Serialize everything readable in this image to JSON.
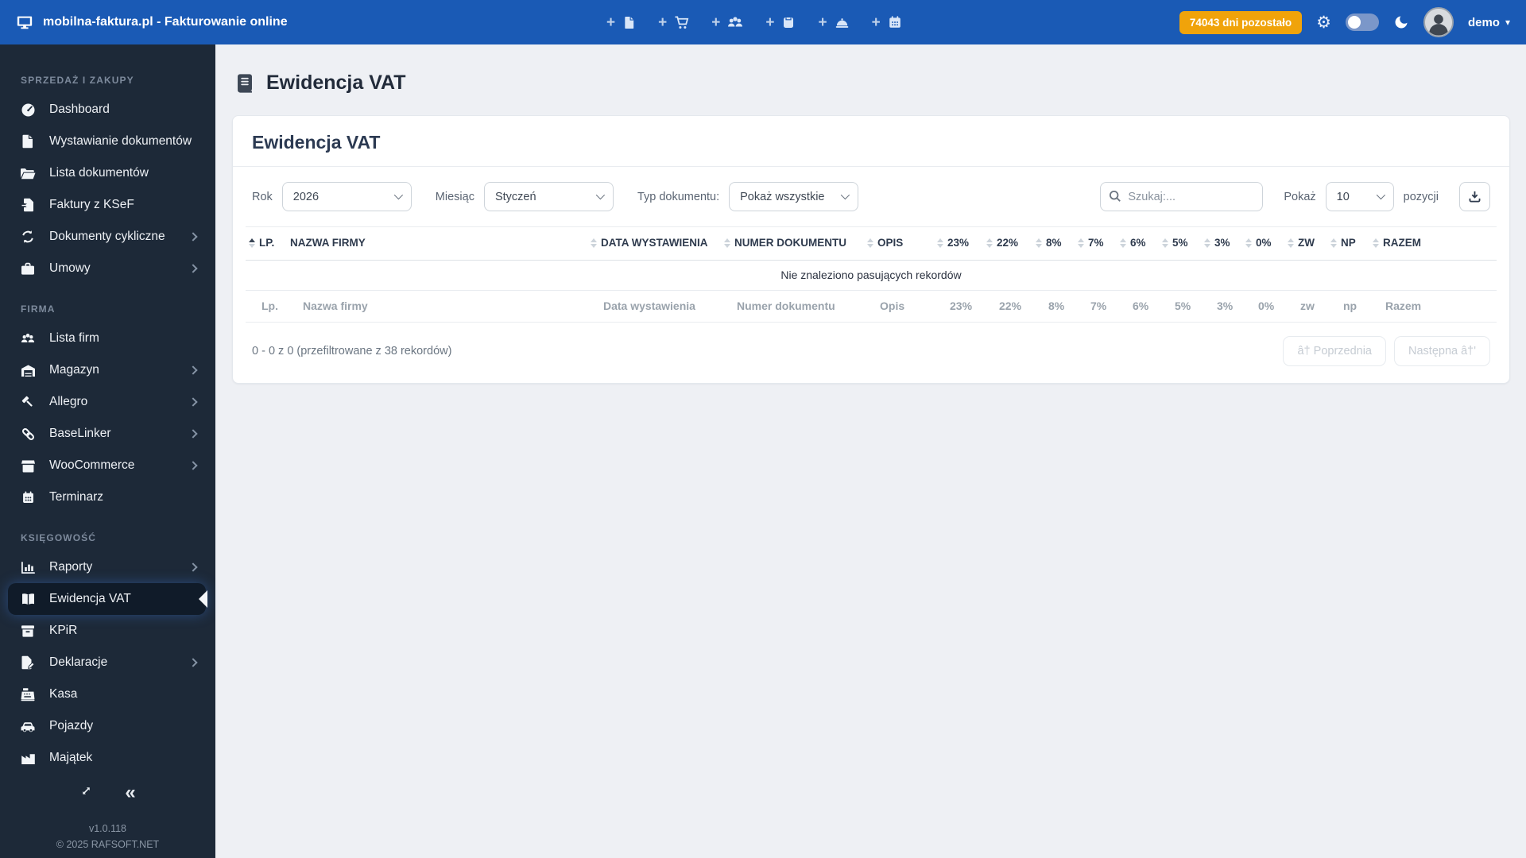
{
  "topbar": {
    "brand": "mobilna-faktura.pl - Fakturowanie online",
    "quick_add": [
      {
        "icon": "add-document-icon"
      },
      {
        "icon": "add-cart-icon"
      },
      {
        "icon": "add-contractor-icon"
      },
      {
        "icon": "add-product-icon"
      },
      {
        "icon": "add-service-icon"
      },
      {
        "icon": "add-event-icon"
      }
    ],
    "trial_badge": "74043 dni pozostało",
    "user": "demo"
  },
  "icons": {
    "plus": "+",
    "gear": "⚙",
    "collapse": "«",
    "caret_down": "▾"
  },
  "sidebar": {
    "sections": [
      {
        "label": "SPRZEDAŻ I ZAKUPY",
        "items": [
          {
            "label": "Dashboard"
          },
          {
            "label": "Wystawianie dokumentów"
          },
          {
            "label": "Lista dokumentów"
          },
          {
            "label": "Faktury z KSeF"
          },
          {
            "label": "Dokumenty cykliczne"
          },
          {
            "label": "Umowy"
          }
        ]
      },
      {
        "label": "FIRMA",
        "items": [
          {
            "label": "Lista firm"
          },
          {
            "label": "Magazyn"
          },
          {
            "label": "Allegro"
          },
          {
            "label": "BaseLinker"
          },
          {
            "label": "WooCommerce"
          },
          {
            "label": "Terminarz"
          }
        ]
      },
      {
        "label": "KSIĘGOWOŚĆ",
        "items": [
          {
            "label": "Raporty"
          },
          {
            "label": "Ewidencja VAT"
          },
          {
            "label": "KPiR"
          },
          {
            "label": "Deklaracje"
          },
          {
            "label": "Kasa"
          },
          {
            "label": "Pojazdy"
          },
          {
            "label": "Majątek"
          }
        ]
      }
    ],
    "footer": {
      "version": "v1.0.118",
      "copyright": "© 2025 RAFSOFT.NET"
    }
  },
  "page": {
    "title": "Ewidencja VAT"
  },
  "card": {
    "title": "Ewidencja VAT",
    "filters": {
      "rok_label": "Rok",
      "rok_value": "2026",
      "miesiac_label": "Miesiąc",
      "miesiac_value": "Styczeń",
      "typ_label": "Typ dokumentu:",
      "typ_value": "Pokaż wszystkie",
      "search_placeholder": "Szukaj:...",
      "pokaz_label": "Pokaż",
      "page_size": "10",
      "pozycji_label": "pozycji"
    },
    "table": {
      "headers": [
        "LP.",
        "NAZWA FIRMY",
        "DATA WYSTAWIENIA",
        "NUMER DOKUMENTU",
        "OPIS",
        "23%",
        "22%",
        "8%",
        "7%",
        "6%",
        "5%",
        "3%",
        "0%",
        "ZW",
        "NP",
        "RAZEM"
      ],
      "empty": "Nie znaleziono pasujących rekordów",
      "footer": [
        "Lp.",
        "Nazwa firmy",
        "Data wystawienia",
        "Numer dokumentu",
        "Opis",
        "23%",
        "22%",
        "8%",
        "7%",
        "6%",
        "5%",
        "3%",
        "0%",
        "zw",
        "np",
        "Razem"
      ]
    },
    "pagination": {
      "info": "0 - 0 z 0 (przefiltrowane z 38 rekordów)",
      "prev": "â† Poprzednia",
      "next": "Następna â†'"
    }
  }
}
